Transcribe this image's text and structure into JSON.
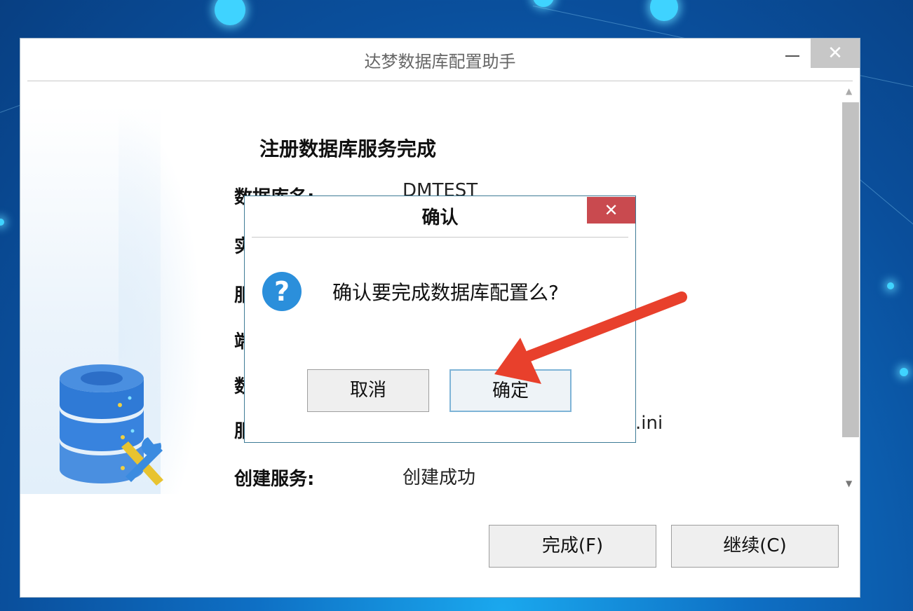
{
  "main_window": {
    "title": "达梦数据库配置助手",
    "section_title": "注册数据库服务完成",
    "rows": [
      {
        "label": "数据库名:",
        "value": "DMTEST"
      },
      {
        "label": "实",
        "value": ""
      },
      {
        "label": "服",
        "value": ""
      },
      {
        "label": "端",
        "value": ""
      },
      {
        "label": "数",
        "value": ""
      },
      {
        "label": "服",
        "value": ".ini"
      },
      {
        "label": "创建服务:",
        "value": "创建成功"
      }
    ],
    "buttons": {
      "finish": "完成(F)",
      "continue": "继续(C)"
    }
  },
  "confirm_dialog": {
    "title": "确认",
    "message": "确认要完成数据库配置么?",
    "icon": "question-icon",
    "buttons": {
      "cancel": "取消",
      "ok": "确定"
    }
  },
  "icons": {
    "close": "✕",
    "question": "?",
    "scroll_up": "▲",
    "scroll_down": "▼"
  },
  "colors": {
    "dialog_close": "#c94a4f",
    "annotation_arrow": "#e8402c",
    "question_icon": "#2b8fdb"
  }
}
